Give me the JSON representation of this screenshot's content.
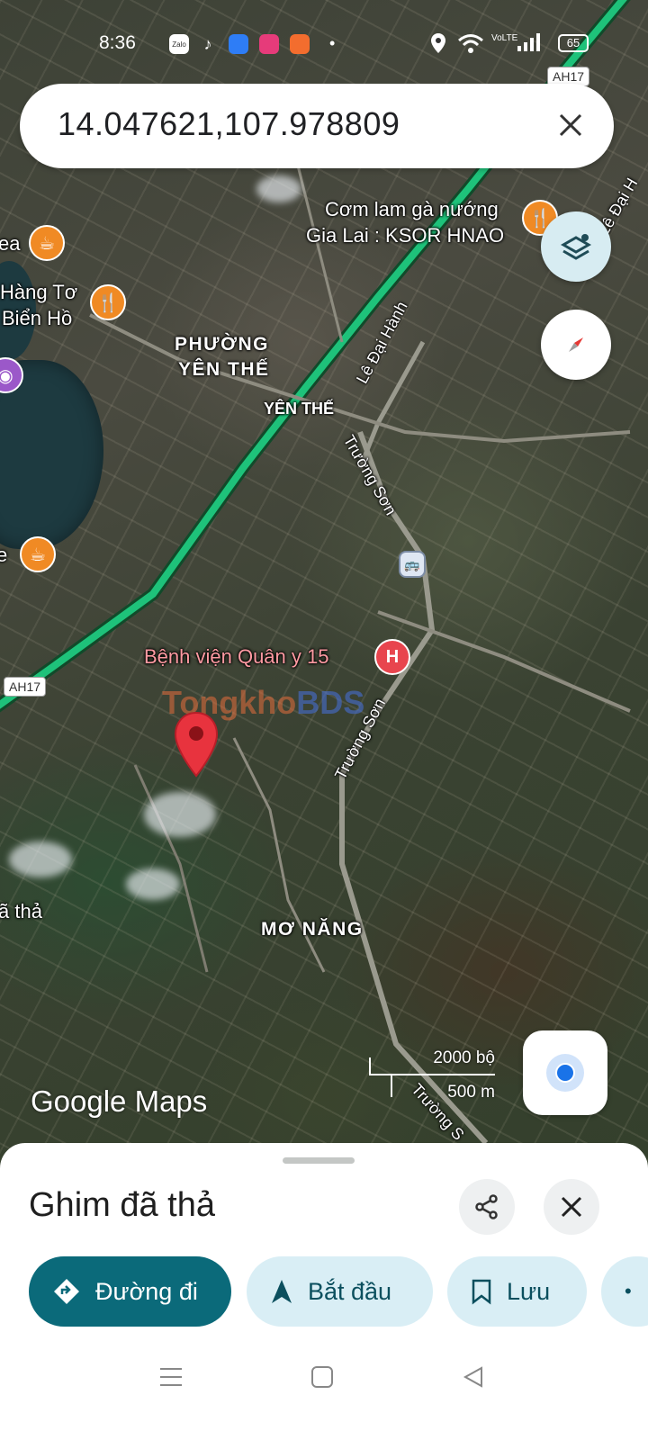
{
  "status_bar": {
    "time": "8:36",
    "apps": [
      "Zalo",
      "TikTok",
      "Messenger",
      "Lazada",
      "Shopee"
    ],
    "battery": "65",
    "network_label": "VoLTE"
  },
  "search": {
    "query": "14.047621,107.978809"
  },
  "map": {
    "labels": {
      "restaurant_ksor_line1": "Cơm lam gà nướng",
      "restaurant_ksor_line2": "Gia Lai : KSOR HNAO",
      "cafe_partial": "ea",
      "hang_to_line1": "Hàng Tơ",
      "hang_to_line2": "Biển Hồ",
      "ward_line1": "PHƯỜNG",
      "ward_line2": "YÊN THẾ",
      "yen_the": "YÊN THẾ",
      "le_dai_hanh": "Lê Đại Hành",
      "truong_son_1": "Trường Sơn",
      "truong_son_2": "Trường Sơn",
      "truong_son_3": "Trường S",
      "top_right_street": "Lê Đại H",
      "cafe2_partial": "e",
      "hospital": "Bệnh viện Quân y 15",
      "ma_tha": "ã thả",
      "mo_nang": "MƠ NĂNG",
      "shield_ah17_top": "AH17",
      "shield_ah17_left": "AH17",
      "watermark_a": "Tongkho",
      "watermark_b": "BDS",
      "hospital_marker": "H"
    },
    "scale_feet": "2000 bộ",
    "scale_meters": "500 m",
    "logo": "Google Maps",
    "colors": {
      "highway": "#1ec27a",
      "pin": "#e8333e",
      "poi_food": "#f08a24",
      "hospital": "#e8454e"
    }
  },
  "sheet": {
    "title": "Ghim đã thả",
    "buttons": {
      "directions": "Đường đi",
      "start": "Bắt đầu",
      "save": "Lưu"
    }
  }
}
